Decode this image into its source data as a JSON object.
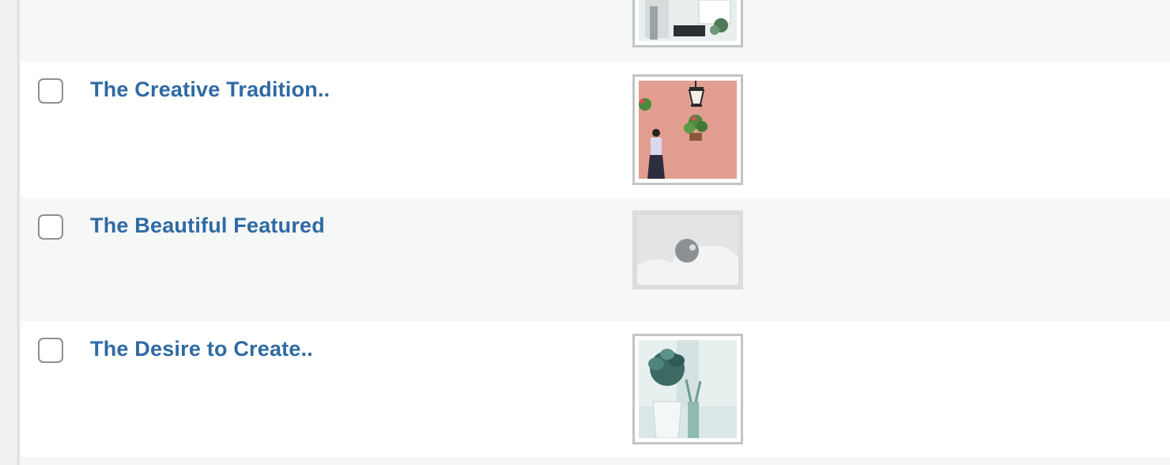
{
  "posts": [
    {
      "title": "The Creative Tradition..",
      "thumbnail": "woman-by-pink-wall-with-lantern"
    },
    {
      "title": "The Beautiful Featured",
      "thumbnail": "image-placeholder"
    },
    {
      "title": "The Desire to Create..",
      "thumbnail": "potted-plant-by-window"
    }
  ],
  "colors": {
    "link": "#2f6aa3",
    "row_alt": "#f6f7f7",
    "row_plain": "#ffffff",
    "thumb_border": "#c3c4c7"
  }
}
